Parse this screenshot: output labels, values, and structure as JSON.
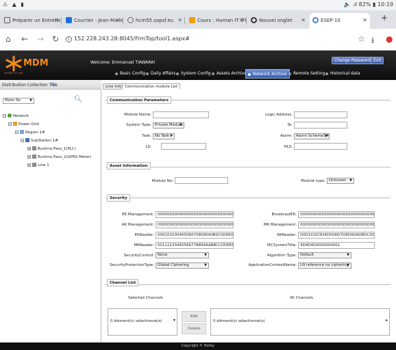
{
  "status_bar": {
    "left_icons": "⚠ ▲ ▮",
    "right_text": "🔈 .ıl 82% ▮ 10:19"
  },
  "browser": {
    "tabs": [
      {
        "title": "Préparer un Entretien",
        "favicon_color": "#555"
      },
      {
        "title": "Courrier - Jean-Marie",
        "favicon_color": "#1e6fd9"
      },
      {
        "title": "hcm55.sapsf.eu",
        "favicon_color": "#666"
      },
      {
        "title": "Cours : Human IT (FR)",
        "favicon_color": "#f0a000"
      },
      {
        "title": "Nouvel onglet",
        "favicon_color": "#333"
      },
      {
        "title": "ESEP-10",
        "favicon_color": "#4a7cc0"
      }
    ],
    "url": "152.228.243.28:8045/FrmTop/tool1.aspx#"
  },
  "app": {
    "logo_text": "MDM",
    "logo_subtext": "AUGEN CO.,LTD",
    "welcome": "Welcome: Emmanuel TIAWARA!",
    "change_password": "Change Password",
    "exit": "Exit",
    "menu": [
      "Basic Config",
      "Daily Affairs",
      "System Config",
      "Assets Archive",
      "Network Archive",
      "Remote Setting",
      "Historical data"
    ],
    "active_menu_index": 4
  },
  "left_panel": {
    "title": "Distribution Collection Tree",
    "select_value": "Meter No",
    "tree": [
      {
        "label": "Network",
        "level": 0
      },
      {
        "label": "Power Grid",
        "level": 1
      },
      {
        "label": "Region 1#",
        "level": 2
      },
      {
        "label": "SubStation 1#",
        "level": 3
      },
      {
        "label": "Burkina Faso_1(PLC)",
        "level": 4
      },
      {
        "label": "Burkina Faso_2(GPRS Meter)",
        "level": 4
      },
      {
        "label": "Line 1",
        "level": 4
      }
    ]
  },
  "content": {
    "tabs": [
      "Line Info",
      "Communication module List"
    ],
    "active_tab_index": 1,
    "comm": {
      "title": "Communication Parameters",
      "module_name_label": "Module Name:",
      "system_type_label": "System Type:",
      "system_type_value": "Private Module",
      "task_label": "Task:",
      "task_value": "No Task",
      "ls_label": "LS:",
      "logic_address_label": "Logic Address:",
      "te_label": "Te:",
      "alarm_label": "Alarm:",
      "alarm_value": "Alarm Scheme1#",
      "hls_label": "HLS:"
    },
    "asset": {
      "title": "Asset Information",
      "module_no_label": "Module No:",
      "module_type_label": "Module type:",
      "module_type_value": "Unknown"
    },
    "security": {
      "title": "Security",
      "ek_label": "EK Management:",
      "ek_value": "00000000000000000000000000000000",
      "ak_label": "AK Management:",
      "ak_value": "00000000000000000000000000000000",
      "ekreader_label": "EKReader:",
      "ekreader_value": "000102030405060708090A0B0C0D0E0F",
      "mkreader_label": "MKReader:",
      "mkreader_value": "00112233445566778899AABBCCDDEEFF",
      "security_control_label": "SecurityControl:",
      "security_control_value": "None",
      "security_protection_label": "SecurityProtectionType:",
      "security_protection_value": "Global Ciphering",
      "broadcast_label": "BroadcastEK:",
      "broadcast_value": "00000000000000000000000000000000",
      "mk_label": "MK Management:",
      "mk_value": "00000000000000000000000000000000",
      "akreader_label": "AKReader:",
      "akreader_value": "D0D1D2D3D4D5D6D7D8D9DADBDCDDDEDF",
      "system_title_label": "IECSystemTitle:",
      "system_title_value": "4D4D4D0000000001",
      "algorithm_label": "Algorithm Type:",
      "algorithm_value": "Default",
      "app_context_label": "ApplicationContextName:",
      "app_context_value": "LN reference no ciphering"
    },
    "channel": {
      "title": "Channel List",
      "selected_label": "Selected Channels",
      "all_label": "All Channels",
      "selected_value": "0 élément(s) sélectionné(s)",
      "all_value": "0 élément(s) sélectionné(s)",
      "add": "Add",
      "delete": "Delete"
    }
  },
  "footer": "Copyright © Holley"
}
